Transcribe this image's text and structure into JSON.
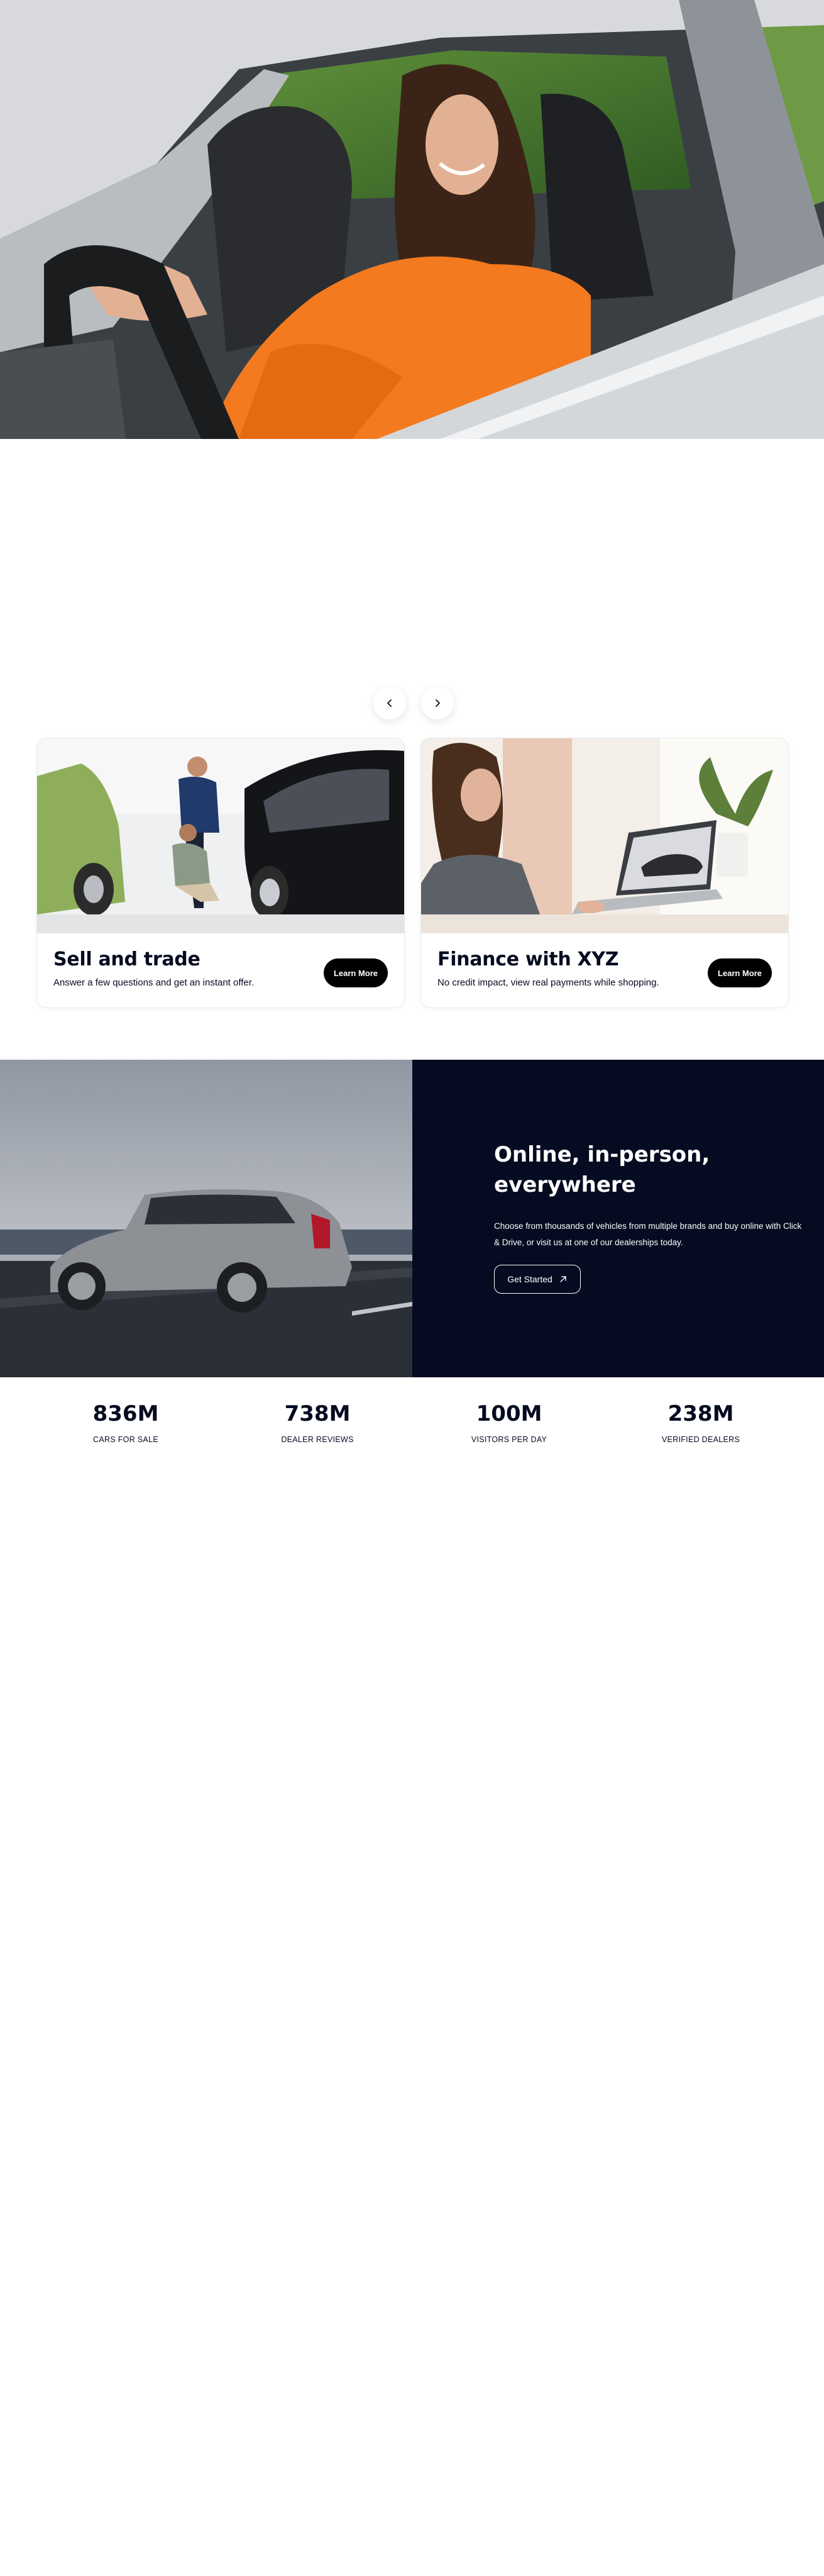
{
  "cards": [
    {
      "title": "Sell and trade",
      "subtitle": "Answer a few questions and get an instant offer.",
      "button": "Learn More"
    },
    {
      "title": "Finance with XYZ",
      "subtitle": "No credit impact, view real payments while shopping.",
      "button": "Learn More"
    }
  ],
  "online": {
    "title": "Online, in-person, everywhere",
    "text": "Choose from thousands of vehicles from multiple brands and buy online with Click & Drive, or visit us at one of our dealerships today.",
    "button": "Get Started"
  },
  "stats": [
    {
      "value": "836M",
      "label": "CARS FOR SALE"
    },
    {
      "value": "738M",
      "label": "DEALER REVIEWS"
    },
    {
      "value": "100M",
      "label": "VISITORS PER DAY"
    },
    {
      "value": "238M",
      "label": "VERIFIED DEALERS"
    }
  ],
  "colors": {
    "dark_navy": "#050b20",
    "button_black": "#000000",
    "orange_shirt": "#f37a1f"
  },
  "icons": {
    "prev": "chevron-left-icon",
    "next": "chevron-right-icon",
    "get_started": "arrow-up-right-icon"
  }
}
